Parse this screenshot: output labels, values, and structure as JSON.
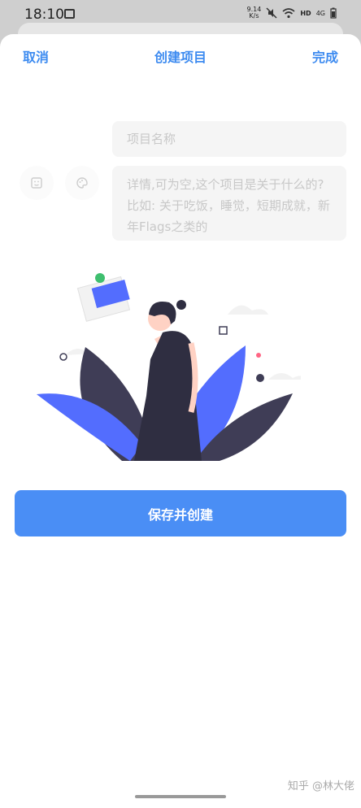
{
  "status_bar": {
    "time": "18:10",
    "net_speed_value": "9.14",
    "net_speed_unit": "K/s",
    "hd_label": "HD",
    "signal_label": "4G"
  },
  "nav": {
    "cancel_label": "取消",
    "title": "创建项目",
    "done_label": "完成"
  },
  "form": {
    "name_placeholder": "项目名称",
    "detail_placeholder": "详情,可为空,这个项目是关于什么的? 比如: 关于吃饭，睡觉，短期成就，新年Flags之类的"
  },
  "actions": {
    "save_label": "保存并创建"
  },
  "watermark": "知乎 @林大佬",
  "colors": {
    "accent": "#3d8bf0",
    "button": "#4a8ef5",
    "illustration_blue": "#536dfe",
    "illustration_dark": "#3f3d56"
  },
  "icons": [
    "image-icon",
    "mute-icon",
    "wifi-icon",
    "battery-icon",
    "emoji-icon",
    "palette-icon"
  ]
}
